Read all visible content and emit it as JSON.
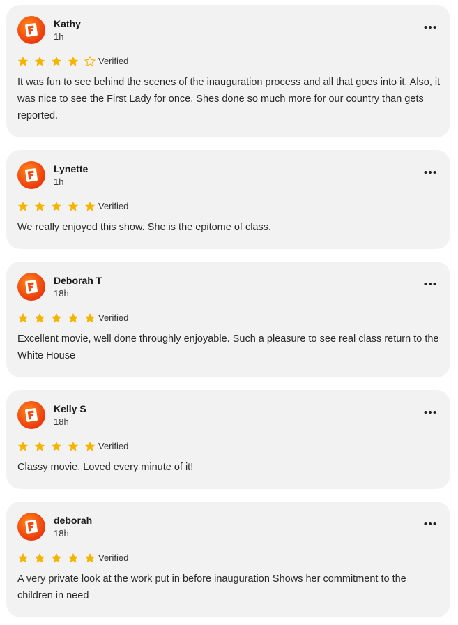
{
  "reviews": [
    {
      "name": "Kathy",
      "time": "1h",
      "rating": 4,
      "verified_label": "Verified",
      "text": "It was fun to see behind the scenes of the inauguration process and all that goes into it. Also, it was nice to see the First Lady for once. Shes done so much more for our country than gets reported."
    },
    {
      "name": "Lynette",
      "time": "1h",
      "rating": 5,
      "verified_label": "Verified",
      "text": "We really enjoyed this show. She is the epitome of class."
    },
    {
      "name": "Deborah T",
      "time": "18h",
      "rating": 5,
      "verified_label": "Verified",
      "text": "Excellent movie, well done throughly enjoyable. Such a pleasure to see real class return to the White House"
    },
    {
      "name": "Kelly S",
      "time": "18h",
      "rating": 5,
      "verified_label": "Verified",
      "text": "Classy movie. Loved every minute of it!"
    },
    {
      "name": "deborah",
      "time": "18h",
      "rating": 5,
      "verified_label": "Verified",
      "text": "A very private look at the work put in before inauguration Shows her commitment to the children in need"
    }
  ],
  "colors": {
    "star_filled": "#f5b400",
    "star_outline": "#f5b400",
    "card_bg": "#f2f2f2",
    "avatar_orange": "#f04a10"
  },
  "icons": {
    "avatar": "fandango-logo-icon",
    "more": "more-options-icon",
    "star": "star-icon"
  }
}
